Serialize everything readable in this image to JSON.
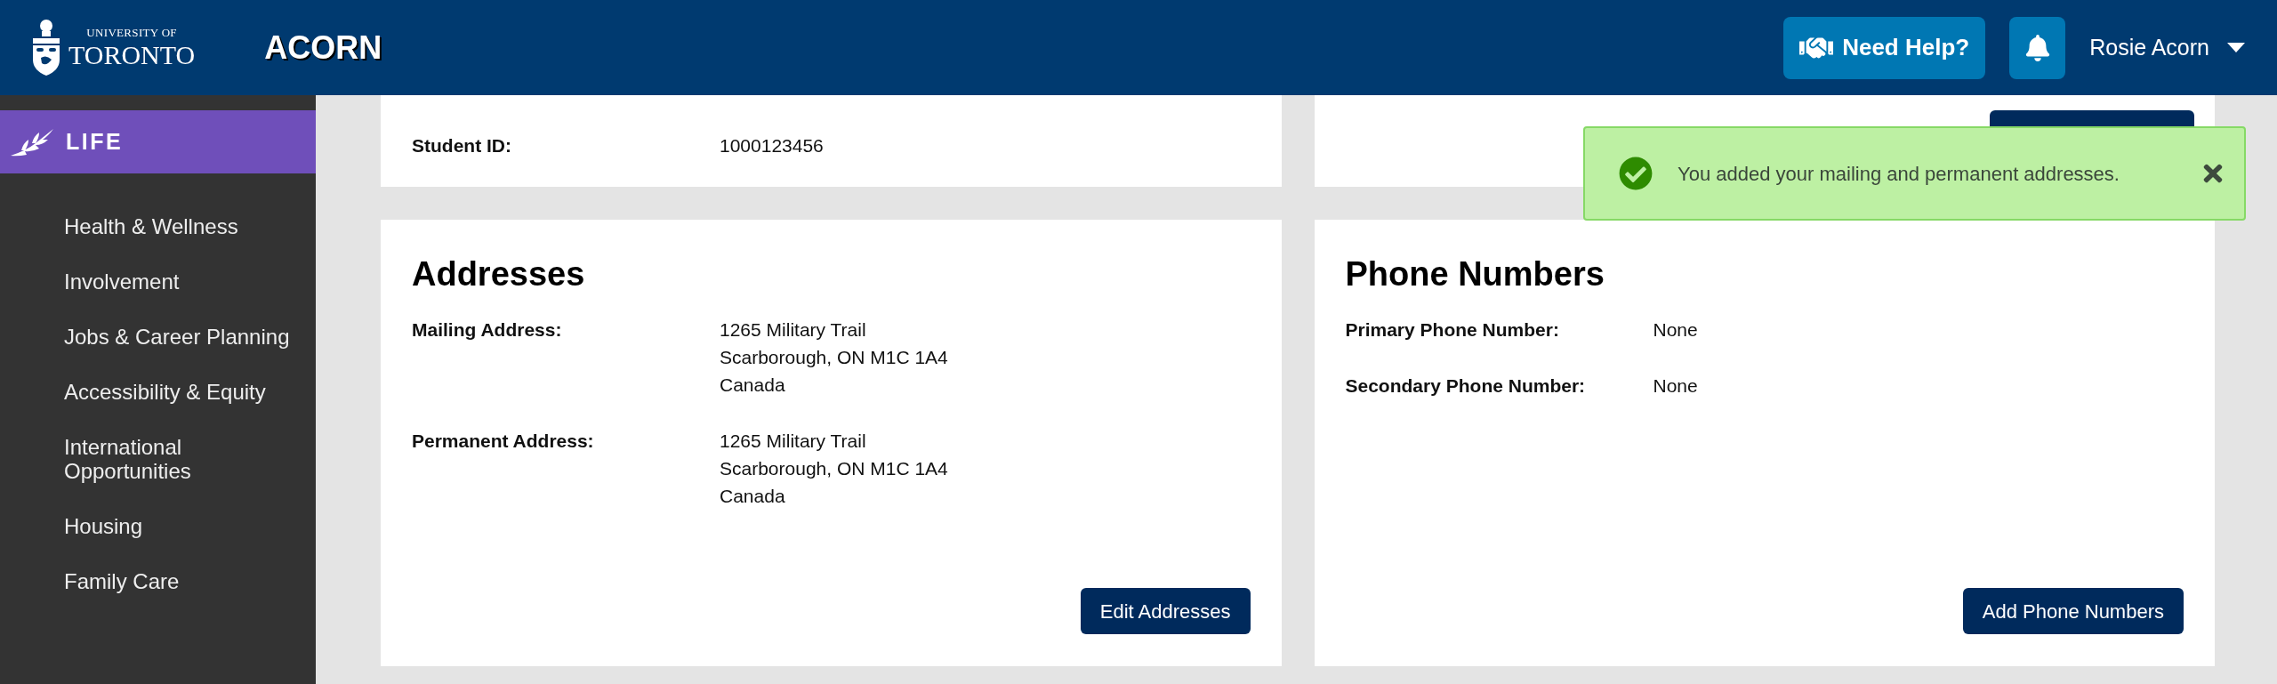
{
  "header": {
    "logo": {
      "line1": "UNIVERSITY OF",
      "line2": "TORONTO"
    },
    "app_title": "ACORN",
    "help_button": "Need Help?",
    "user_menu": "Rosie Acorn"
  },
  "sidebar": {
    "section": {
      "label": "LIFE",
      "selected": true
    },
    "items": [
      {
        "label": "Health & Wellness"
      },
      {
        "label": "Involvement"
      },
      {
        "label": "Jobs & Career Planning"
      },
      {
        "label": "Accessibility & Equity"
      },
      {
        "label": "International Opportunities"
      },
      {
        "label": "Housing"
      },
      {
        "label": "Family Care"
      }
    ]
  },
  "cards": [
    {
      "fields": [
        {
          "label": "Student ID:",
          "value": [
            "1000123456"
          ]
        }
      ]
    },
    {
      "kind": "button-only"
    },
    {
      "title": "Addresses",
      "fields": [
        {
          "label": "Mailing Address:",
          "value": [
            "1265 Military Trail",
            "Scarborough, ON M1C 1A4",
            "Canada"
          ]
        },
        {
          "label": "Permanent Address:",
          "value": [
            "1265 Military Trail",
            "Scarborough, ON M1C 1A4",
            "Canada"
          ]
        }
      ],
      "button": "Edit Addresses"
    },
    {
      "title": "Phone Numbers",
      "fields": [
        {
          "label": "Primary Phone Number:",
          "value": [
            "None"
          ]
        },
        {
          "label": "Secondary Phone Number:",
          "value": [
            "None"
          ]
        }
      ],
      "button": "Add Phone Numbers"
    }
  ],
  "toast": {
    "message": "You added your mailing and permanent addresses.",
    "kind": "success"
  }
}
